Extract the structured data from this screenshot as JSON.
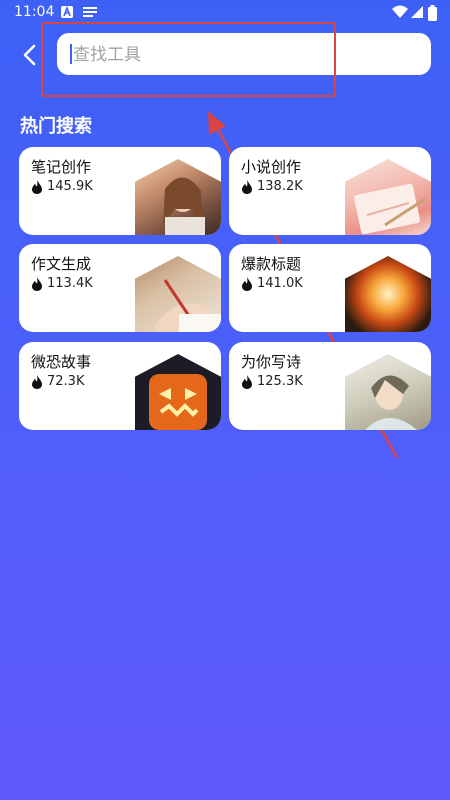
{
  "status_bar": {
    "time": "11:04"
  },
  "search": {
    "placeholder": "查找工具"
  },
  "section": {
    "title": "热门搜索"
  },
  "tools": [
    {
      "name": "笔记创作",
      "count": "145.9K",
      "thumb_colors": [
        "#6b4a3a",
        "#e6c2a0"
      ]
    },
    {
      "name": "小说创作",
      "count": "138.2K",
      "thumb_colors": [
        "#f3b8b0",
        "#f7e3d8"
      ]
    },
    {
      "name": "作文生成",
      "count": "113.4K",
      "thumb_colors": [
        "#c09a78",
        "#efe3d2"
      ]
    },
    {
      "name": "爆款标题",
      "count": "141.0K",
      "thumb_colors": [
        "#2b1b12",
        "#f7a53a"
      ]
    },
    {
      "name": "微恐故事",
      "count": "72.3K",
      "thumb_colors": [
        "#1d1c26",
        "#f06a1a"
      ]
    },
    {
      "name": "为你写诗",
      "count": "125.3K",
      "thumb_colors": [
        "#dcdacb",
        "#8e8a75"
      ]
    }
  ],
  "colors": {
    "accent": "#3d61f7",
    "annotation": "#d84545"
  }
}
